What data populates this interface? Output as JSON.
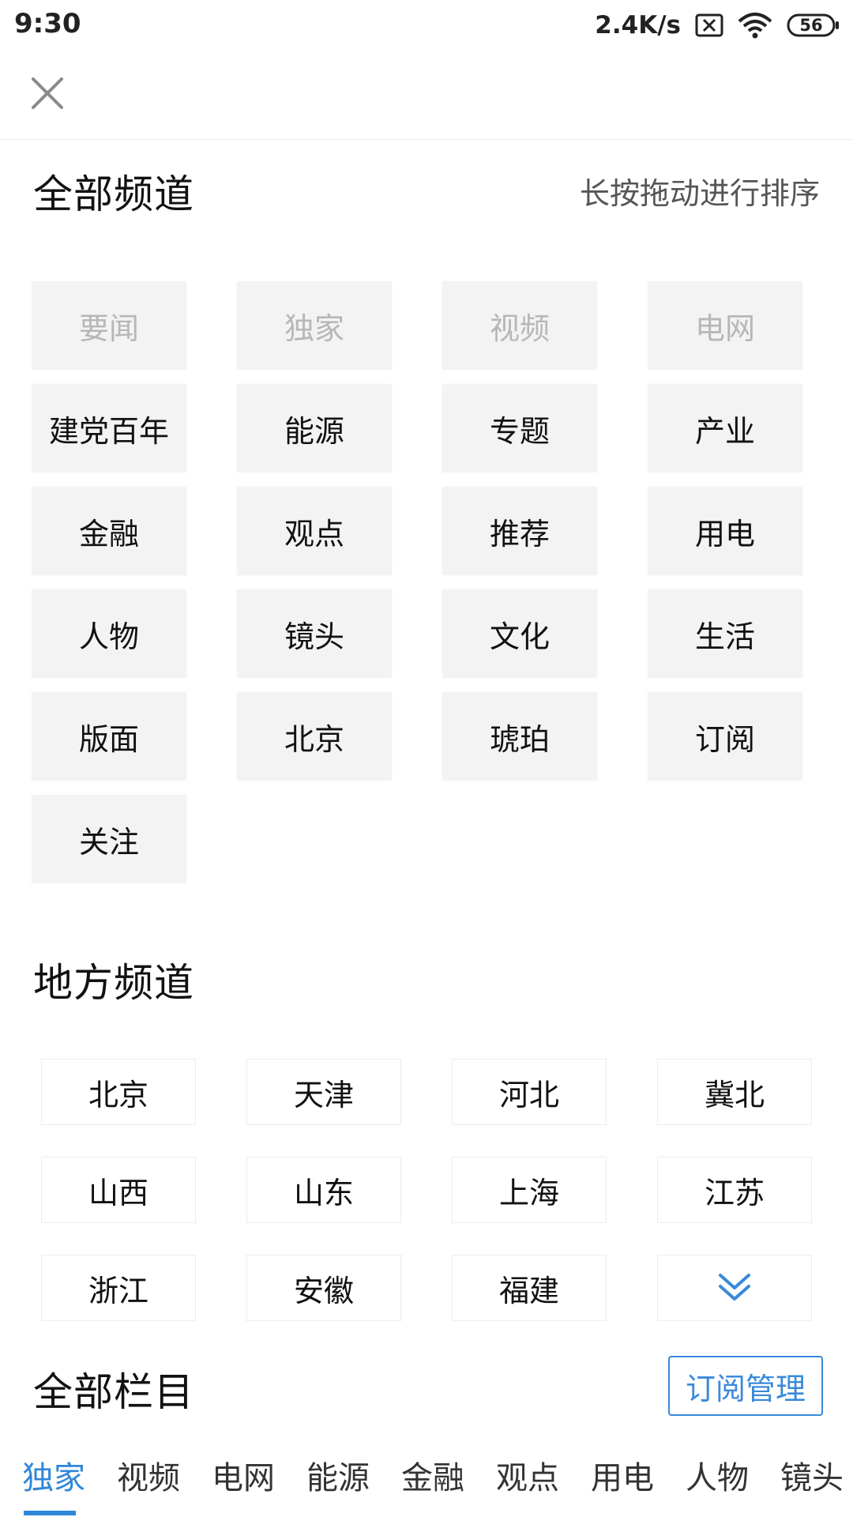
{
  "status": {
    "time": "9:30",
    "net_speed": "2.4K/s",
    "battery": "56",
    "icons": [
      "sim-off-icon",
      "wifi-icon",
      "battery-icon"
    ]
  },
  "header": {
    "close_icon": "close-icon"
  },
  "all_channels": {
    "title": "全部频道",
    "hint": "长按拖动进行排序",
    "fixed": [
      "要闻",
      "独家",
      "视频",
      "电网"
    ],
    "items": [
      "建党百年",
      "能源",
      "专题",
      "产业",
      "金融",
      "观点",
      "推荐",
      "用电",
      "人物",
      "镜头",
      "文化",
      "生活",
      "版面",
      "北京",
      "琥珀",
      "订阅",
      "关注"
    ]
  },
  "local_channels": {
    "title": "地方频道",
    "items": [
      "北京",
      "天津",
      "河北",
      "冀北",
      "山西",
      "山东",
      "上海",
      "江苏",
      "浙江",
      "安徽",
      "福建"
    ],
    "expand_icon": "double-chevron-down-icon"
  },
  "columns": {
    "title": "全部栏目",
    "manage_label": "订阅管理",
    "tabs": [
      "独家",
      "视频",
      "电网",
      "能源",
      "金融",
      "观点",
      "用电",
      "人物",
      "镜头"
    ],
    "active_tab": "独家"
  },
  "colors": {
    "accent": "#2f87d8",
    "chip_bg": "#f3f3f3",
    "fixed_text": "#b7b7b7"
  }
}
